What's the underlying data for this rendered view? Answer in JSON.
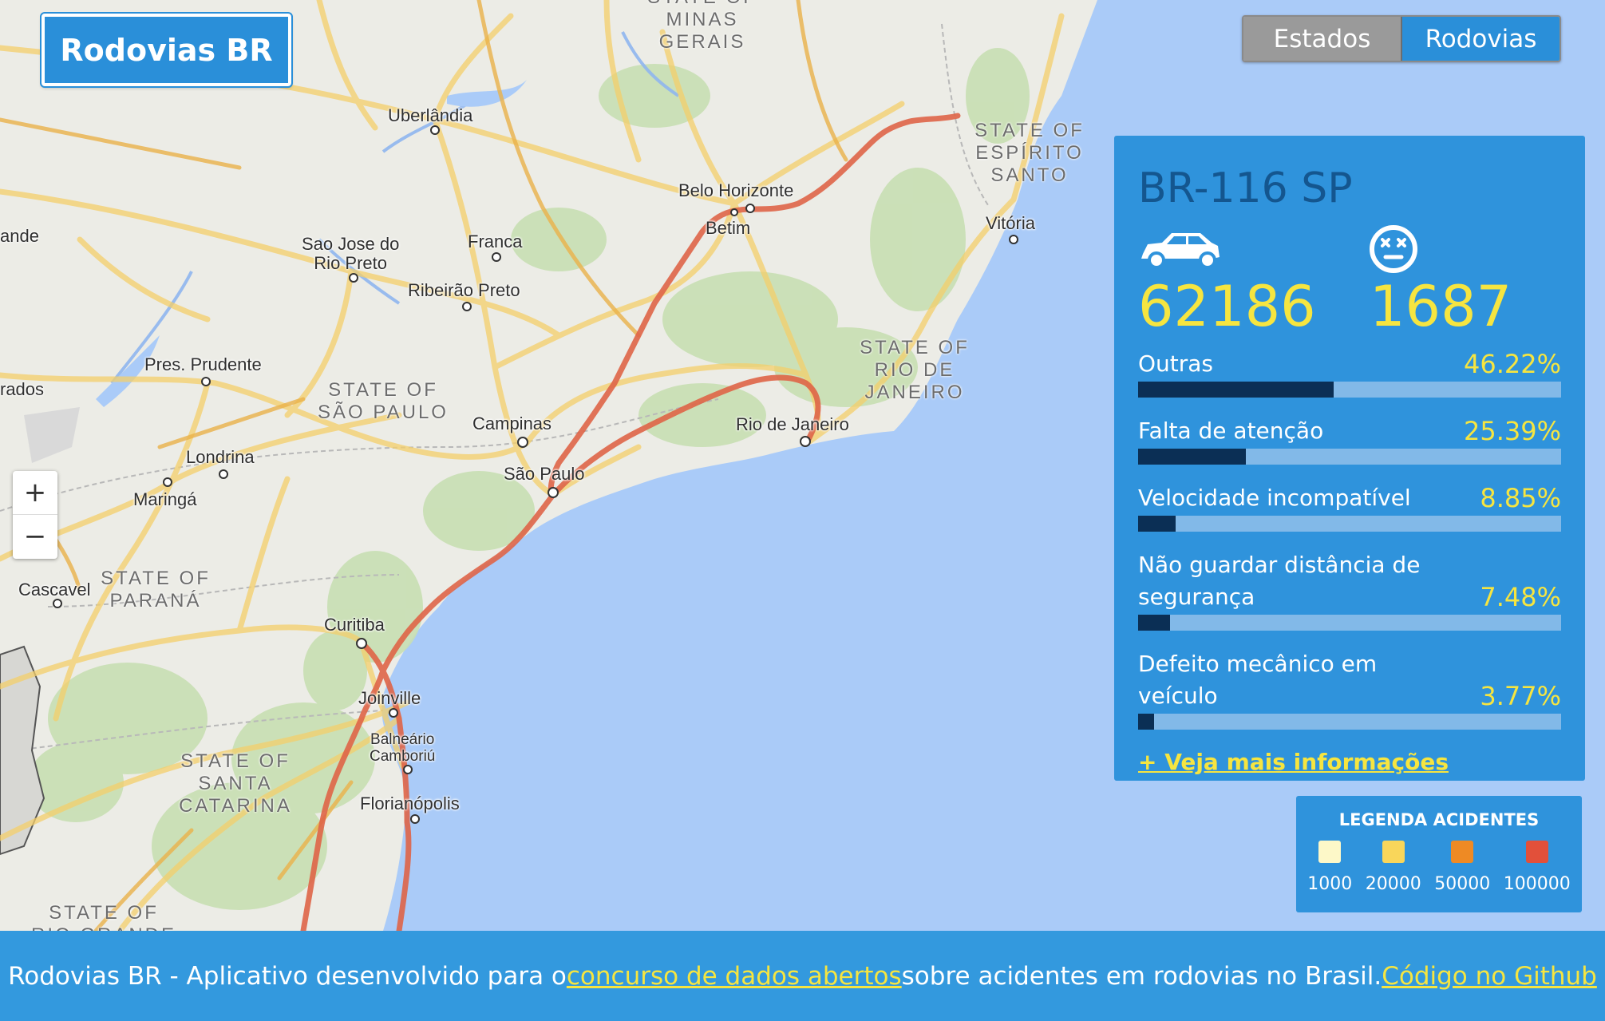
{
  "app": {
    "title": "Rodovias BR"
  },
  "toggle": {
    "estados_label": "Estados",
    "rodovias_label": "Rodovias",
    "active": "Rodovias"
  },
  "zoom": {
    "in_label": "+",
    "out_label": "−"
  },
  "map": {
    "cities": [
      {
        "id": "uberlandia",
        "label": "Uberlândia"
      },
      {
        "id": "belo-horizonte",
        "label": "Belo Horizonte"
      },
      {
        "id": "betim",
        "label": "Betim"
      },
      {
        "id": "vitoria",
        "label": "Vitória"
      },
      {
        "id": "sao-jose-rio-preto",
        "label": "Sao Jose do\nRio Preto"
      },
      {
        "id": "franca",
        "label": "Franca"
      },
      {
        "id": "ribeirao-preto",
        "label": "Ribeirão Preto"
      },
      {
        "id": "pres-prudente",
        "label": "Pres. Prudente"
      },
      {
        "id": "campinas",
        "label": "Campinas"
      },
      {
        "id": "sao-paulo",
        "label": "São Paulo"
      },
      {
        "id": "rio-de-janeiro",
        "label": "Rio de Janeiro"
      },
      {
        "id": "londrina",
        "label": "Londrina"
      },
      {
        "id": "maringa",
        "label": "Maringá"
      },
      {
        "id": "cascavel",
        "label": "Cascavel"
      },
      {
        "id": "curitiba",
        "label": "Curitiba"
      },
      {
        "id": "joinville",
        "label": "Joinville"
      },
      {
        "id": "balneario",
        "label": "Balneário\nCamboriú"
      },
      {
        "id": "florianopolis",
        "label": "Florianópolis"
      },
      {
        "id": "ande",
        "label": "ande"
      },
      {
        "id": "rados",
        "label": "rados"
      }
    ],
    "regions": [
      {
        "id": "minas-gerais",
        "label": "STATE OF\nMINAS\nGERAIS"
      },
      {
        "id": "espirito-santo",
        "label": "STATE OF\nESPÍRITO\nSANTO"
      },
      {
        "id": "rio-de-janeiro-state",
        "label": "STATE OF\nRIO DE\nJANEIRO"
      },
      {
        "id": "sao-paulo-state",
        "label": "STATE OF\nSÃO PAULO"
      },
      {
        "id": "parana",
        "label": "STATE OF\nPARANÁ"
      },
      {
        "id": "santa-catarina",
        "label": "STATE OF\nSANTA\nCATARINA"
      },
      {
        "id": "rio-grande",
        "label": "STATE OF\nRIO GRANDE"
      }
    ]
  },
  "panel": {
    "road": "BR-116 SP",
    "accidents": "62186",
    "deaths": "1687",
    "causes": [
      {
        "label": "Outras",
        "percent": "46.22%",
        "fraction": 0.4622
      },
      {
        "label": "Falta de atenção",
        "percent": "25.39%",
        "fraction": 0.2539
      },
      {
        "label": "Velocidade incompatível",
        "percent": "8.85%",
        "fraction": 0.0885
      },
      {
        "label": "Não guardar distância de segurança",
        "percent": "7.48%",
        "fraction": 0.0748
      },
      {
        "label": "Defeito mecânico em veículo",
        "percent": "3.77%",
        "fraction": 0.0377
      }
    ],
    "more_link": "+ Veja mais informações"
  },
  "legend": {
    "title": "LEGENDA ACIDENTES",
    "items": [
      {
        "label": "1000",
        "color": "#fdf8c8"
      },
      {
        "label": "20000",
        "color": "#f9d65a"
      },
      {
        "label": "50000",
        "color": "#ee8a24"
      },
      {
        "label": "100000",
        "color": "#e2503a"
      }
    ]
  },
  "footer": {
    "text_before": "Rodovias BR - Aplicativo desenvolvido para o ",
    "link1": "concurso de dados abertos",
    "text_middle": " sobre acidentes em rodovias no Brasil. ",
    "link2": "Código no Github"
  }
}
